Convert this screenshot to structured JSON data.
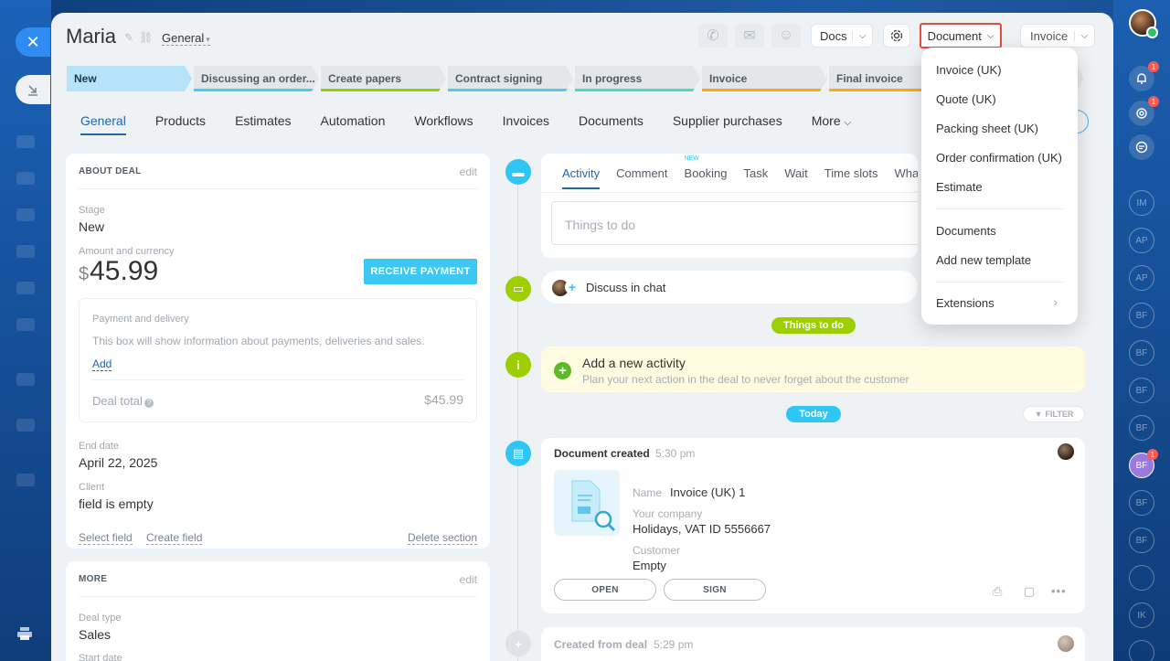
{
  "deal": {
    "title": "Maria",
    "category": "General"
  },
  "header": {
    "docs_label": "Docs",
    "document_label": "Document",
    "invoice_label": "Invoice"
  },
  "stages": [
    {
      "label": "New",
      "color": "#b6e3fa"
    },
    {
      "label": "Discussing an order...",
      "color": "#3dd1f5"
    },
    {
      "label": "Create papers",
      "color": "#8bd400"
    },
    {
      "label": "Contract signing",
      "color": "#54c7f2"
    },
    {
      "label": "In progress",
      "color": "#4ad9c4"
    },
    {
      "label": "Invoice",
      "color": "#ffa90b"
    },
    {
      "label": "Final invoice",
      "color": "#ffa90b"
    }
  ],
  "tabs": [
    "General",
    "Products",
    "Estimates",
    "Automation",
    "Workflows",
    "Invoices",
    "Documents",
    "Supplier purchases",
    "More"
  ],
  "about_deal": {
    "heading": "ABOUT DEAL",
    "edit": "edit",
    "stage_label": "Stage",
    "stage_value": "New",
    "amount_label": "Amount and currency",
    "currency_symbol": "$",
    "amount_value": "45.99",
    "receive_payment": "RECEIVE PAYMENT",
    "payment_delivery_title": "Payment and delivery",
    "payment_delivery_desc": "This box will show information about payments, deliveries and sales.",
    "add_link": "Add",
    "deal_total_label": "Deal total",
    "deal_total_help": "?",
    "deal_total_value": "$45.99",
    "end_date_label": "End date",
    "end_date_value": "April 22, 2025",
    "client_label": "Client",
    "client_value": "field is empty",
    "select_field": "Select field",
    "create_field": "Create field",
    "delete_section": "Delete section"
  },
  "more_card": {
    "heading": "MORE",
    "edit": "edit",
    "deal_type_label": "Deal type",
    "deal_type_value": "Sales",
    "start_date_label": "Start date"
  },
  "activity": {
    "tabs": [
      "Activity",
      "Comment",
      "Booking",
      "Task",
      "Wait",
      "Time slots",
      "What"
    ],
    "booking_badge": "NEW",
    "input_placeholder": "Things to do"
  },
  "chat": {
    "label": "Discuss in chat"
  },
  "things_to_do_pill": "Things to do",
  "add_activity": {
    "title": "Add a new activity",
    "desc": "Plan your next action in the deal to never forget about the customer"
  },
  "today_pill": "Today",
  "filter_label": "FILTER",
  "doc_created": {
    "heading": "Document created",
    "time": "5:30 pm",
    "name_label": "Name",
    "name_value": "Invoice (UK) 1",
    "company_label": "Your company",
    "company_value": "Holidays, VAT ID 5556667",
    "customer_label": "Customer",
    "customer_value": "Empty",
    "open": "OPEN",
    "sign": "SIGN"
  },
  "created_from_deal": {
    "heading": "Created from deal",
    "time": "5:29 pm"
  },
  "dropdown": {
    "items": [
      "Invoice (UK)",
      "Quote (UK)",
      "Packing sheet (UK)",
      "Order confirmation (UK)",
      "Estimate"
    ],
    "items2": [
      "Documents",
      "Add new template"
    ],
    "extensions": "Extensions"
  },
  "right_strip": {
    "notif_badge": "1",
    "chat_badge": "1",
    "users": [
      "IM",
      "AP",
      "AP",
      "BF",
      "BF",
      "BF",
      "BF",
      "BF",
      "BF",
      "BF",
      "",
      "IK",
      ""
    ],
    "user_badge": "1"
  },
  "colors": {
    "accent": "#2067b0",
    "primary_button": "#3bc8f5",
    "highlight_border": "#e84c3d"
  }
}
